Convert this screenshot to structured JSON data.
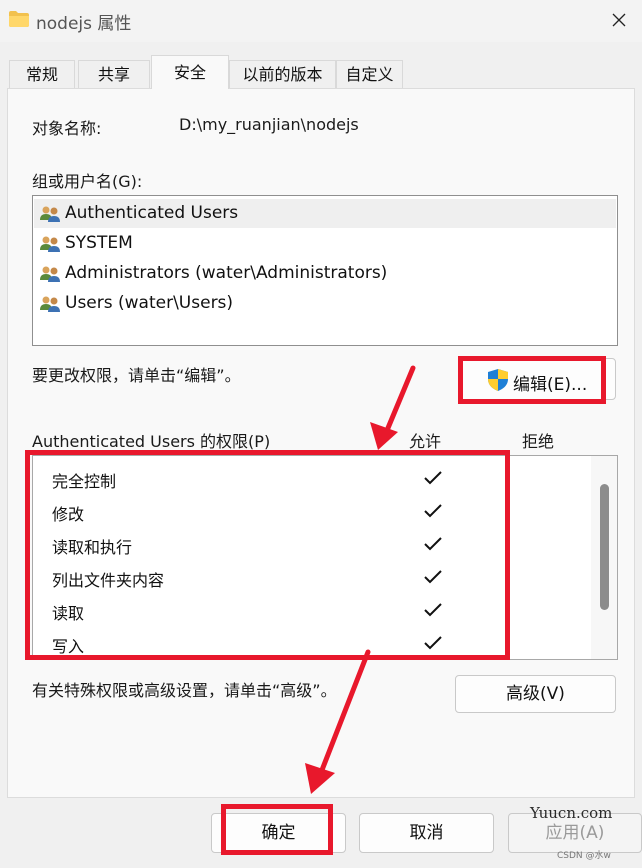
{
  "window": {
    "title": "nodejs 属性"
  },
  "tabs": [
    {
      "label": "常规"
    },
    {
      "label": "共享"
    },
    {
      "label": "安全"
    },
    {
      "label": "以前的版本"
    },
    {
      "label": "自定义"
    }
  ],
  "security": {
    "object_name_label": "对象名称:",
    "object_name_value": "D:\\my_ruanjian\\nodejs",
    "group_label": "组或用户名(G):",
    "users": [
      {
        "label": "Authenticated Users",
        "selected": true
      },
      {
        "label": "SYSTEM"
      },
      {
        "label": "Administrators (water\\Administrators)"
      },
      {
        "label": "Users (water\\Users)"
      }
    ],
    "change_hint": "要更改权限，请单击“编辑”。",
    "edit_button": "编辑(E)...",
    "permissions_label": "Authenticated Users 的权限(P)",
    "allow_header": "允许",
    "deny_header": "拒绝",
    "permissions": [
      {
        "name": "完全控制",
        "allow": true,
        "deny": false
      },
      {
        "name": "修改",
        "allow": true,
        "deny": false
      },
      {
        "name": "读取和执行",
        "allow": true,
        "deny": false
      },
      {
        "name": "列出文件夹内容",
        "allow": true,
        "deny": false
      },
      {
        "name": "读取",
        "allow": true,
        "deny": false
      },
      {
        "name": "写入",
        "allow": true,
        "deny": false
      }
    ],
    "advanced_hint": "有关特殊权限或高级设置，请单击“高级”。",
    "advanced_button": "高级(V)"
  },
  "footer": {
    "ok_button": "确定",
    "cancel_button": "取消",
    "apply_button": "应用(A)"
  },
  "watermark": {
    "site": "Yuucn.com",
    "credit": "CSDN @水w"
  },
  "colors": {
    "highlight_border": "#e8182c",
    "selected_row": "#efefef"
  }
}
